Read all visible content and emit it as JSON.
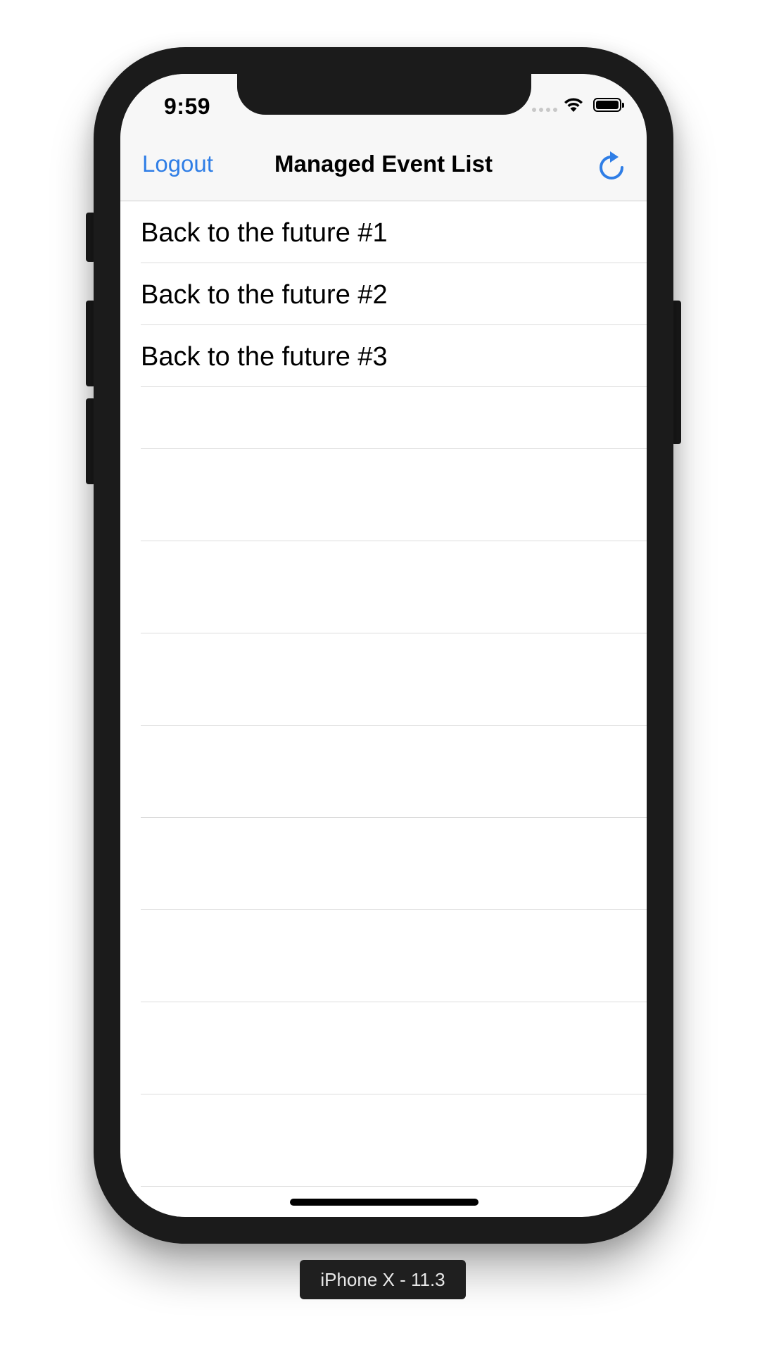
{
  "status_bar": {
    "time": "9:59"
  },
  "nav_bar": {
    "left_button": "Logout",
    "title": "Managed Event List",
    "right_icon": "refresh-icon"
  },
  "events": [
    {
      "label": "Back to the future #1"
    },
    {
      "label": "Back to the future #2"
    },
    {
      "label": "Back to the future #3"
    }
  ],
  "device_label": "iPhone X - 11.3",
  "colors": {
    "accent": "#2f7ee6",
    "navbar_bg": "#f7f7f7",
    "bezel": "#1b1b1b"
  }
}
